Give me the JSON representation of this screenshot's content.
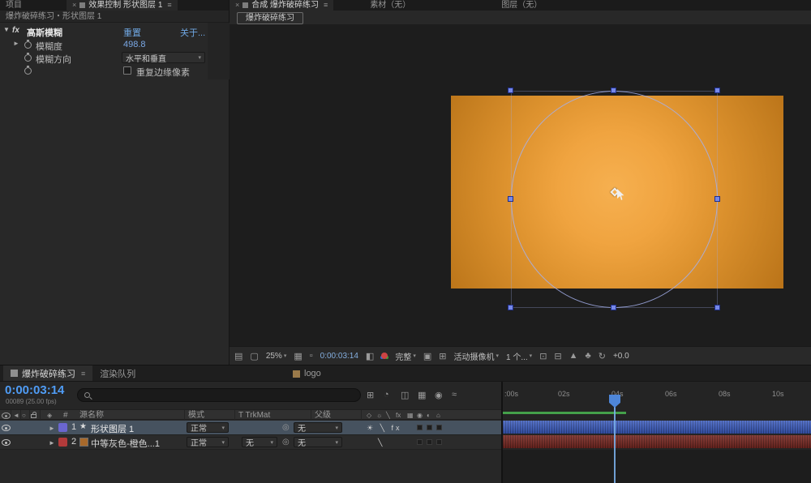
{
  "colors": {
    "accent_blue": "#4f9cf5",
    "link_blue": "#6fa7e2",
    "selection_row": "#46525f",
    "label_violet": "#6a66cf",
    "label_red": "#b13a3a",
    "solid_orange": "#a8692b",
    "bar_blue": "#3b5cc0",
    "bar_maroon": "#7b2a24",
    "preview_green": "#44a04a",
    "canvas_orange_center": "#f3a947",
    "canvas_orange_edge": "#bd771d"
  },
  "effect_panel": {
    "tabs": {
      "project": "项目",
      "effect_controls": "效果控制 形状图层 1"
    },
    "close_icon": "×",
    "menu_icon": "≡",
    "breadcrumb": "爆炸破碎练习・形状图层 1",
    "effect": {
      "collapse_icon": "▼",
      "fx_badge": "fx",
      "name": "高斯模糊",
      "reset": "重置",
      "about": "关于...",
      "blurriness": {
        "expander": "►",
        "label": "模糊度",
        "value": "498.8"
      },
      "direction": {
        "label": "模糊方向",
        "value": "水平和垂直",
        "arrow": "▾"
      },
      "repeat_edge": {
        "label": "重复边缘像素"
      }
    }
  },
  "viewer": {
    "close_icon": "×",
    "menu_icon": "≡",
    "tab_composition": "合成 爆炸破碎练习",
    "tab_footage": "素材（无）",
    "tab_layer": "图层（无）",
    "comp_chip": "爆炸破碎练习",
    "toolbar": {
      "monitor_icon": "▤",
      "monitor2_icon": "▢",
      "zoom": "25%",
      "arrow": "▾",
      "grid_icon": "▦",
      "roi_icon": "▫",
      "timecode": "0:00:03:14",
      "snapshot_icon": "◧",
      "resolution": "完整",
      "region_icon": "▣",
      "checker_icon": "⊞",
      "camera": "活动摄像机",
      "views": "1 个...",
      "layout1_icon": "⊡",
      "layout2_icon": "⊟",
      "layout3_icon": "▲",
      "layout4_icon": "♣",
      "reset_icon": "↻",
      "exposure": "+0.0"
    }
  },
  "timeline": {
    "tab_icon": "■",
    "tab_comp": "爆炸破碎练习",
    "tab_render_queue": "渲染队列",
    "tab_logo": "logo",
    "menu_icon": "≡",
    "timecode": "0:00:03:14",
    "frame_info": "00089 (25.00 fps)",
    "tools": {
      "mini_flowchart": "⊞",
      "draft_3d": "◔",
      "shy": "◫",
      "frame_blend": "▦",
      "motion_blur": "◉",
      "graph_editor": "≈"
    },
    "columns": {
      "audio_icon": "◄",
      "solo_icon": "○",
      "label_icon": "◈",
      "hash": "#",
      "source_name": "源名称",
      "mode": "模式",
      "trkmat": "T TrkMat",
      "parent": "父级"
    },
    "switch_icons": {
      "shy": "◇",
      "collapse": "☼",
      "quality": "╲",
      "fx": "fx",
      "frame_blend": "▦",
      "motion_blur": "◉",
      "adjustment": "◐",
      "three_d": "⌂"
    },
    "dropdown_arrow": "▾",
    "expand_icon": "►",
    "pickwhip_icon": "◎",
    "layers": [
      {
        "index": "1",
        "icon": "★",
        "name": "形状图层 1",
        "mode": "正常",
        "trkmat": "",
        "parent": "无",
        "switches": "☀ ╲ fx"
      },
      {
        "index": "2",
        "name": "中等灰色-橙色...1",
        "mode": "正常",
        "trkmat": "无",
        "parent": "无",
        "switches": "╲"
      }
    ],
    "ruler_ticks": [
      ":00s",
      "02s",
      "04s",
      "06s",
      "08s",
      "10s"
    ]
  }
}
